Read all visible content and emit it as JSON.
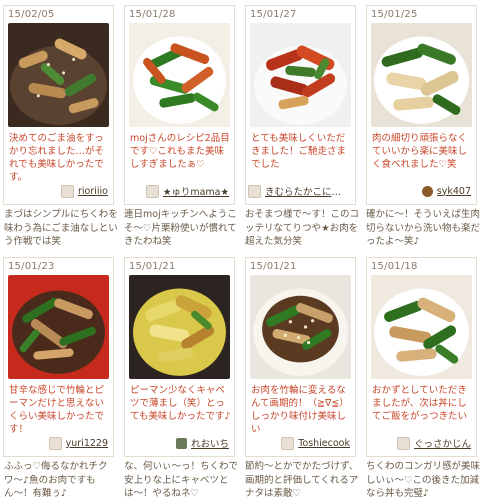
{
  "cards": [
    {
      "date": "15/02/05",
      "description": "決めてのごま油をすっかり忘れました…がそれでも美味しかったです。",
      "author": "rioriiio",
      "avatar_icon": "chef-icon",
      "reply": "まづはシンプルにちくわを味わう為にごま油なしという作戦では笑"
    },
    {
      "date": "15/01/28",
      "description": "mojさんのレシピ2品目です♡これもまた美味しすぎましたぁ♡",
      "author": "★ゅりmama★",
      "avatar_icon": "chef-icon",
      "reply": "連日mojキッチンへようこそ〜♡片栗粉使いが慣れてきたわね笑"
    },
    {
      "date": "15/01/27",
      "description": "とても美味しくいただきました！ご馳走さまでした",
      "author": "きむらたかこになる",
      "avatar_icon": "chef-icon",
      "reply": "おそまつ様で〜す！このコッテリなてりつや★お肉を超えた気分笑"
    },
    {
      "date": "15/01/25",
      "description": "肉の細切り頑張らなくていいから楽に美味しく食べれました♡笑",
      "author": "syk407",
      "avatar_icon": "user-photo-icon",
      "reply": "確かに〜！そういえば生肉切らないから洗い物も楽だったよ〜笑♪"
    },
    {
      "date": "15/01/23",
      "description": "甘辛な感じで竹輪とピーマンだけと思えないくらい美味しかったです！",
      "author": "yuri1229",
      "avatar_icon": "chef-icon",
      "reply": "ふふっ♡侮るなかれチクワ〜♪魚のお肉ですもん〜！有難ぅ♪"
    },
    {
      "date": "15/01/21",
      "description": "ピーマン少なくキャベツで薄まし（笑）とっても美味しかったです♪",
      "author": "れおいち",
      "avatar_icon": "user-photo-icon",
      "reply": "な、何いぃ〜っ！ちくわで安上りな上にキャベツとは〜！やるねネ♡"
    },
    {
      "date": "15/01/21",
      "description": "お肉を竹輪に変えるなんて画期的！（≧∇≦）しっかり味付け美味しい",
      "author": "Toshiecook",
      "avatar_icon": "chef-icon",
      "reply": "節約〜とかでかたづけず、画期的と評価してくれるアナタは素敵♡"
    },
    {
      "date": "15/01/18",
      "description": "おかずとしていただきましたが、次は丼にしてご飯をがっつきたい",
      "author": "ぐっさかじん",
      "avatar_icon": "chef-icon",
      "reply": "ちくわのコンガリ感が美味しいぃ〜♡この後きた加減なら丼も完璧♪"
    }
  ]
}
